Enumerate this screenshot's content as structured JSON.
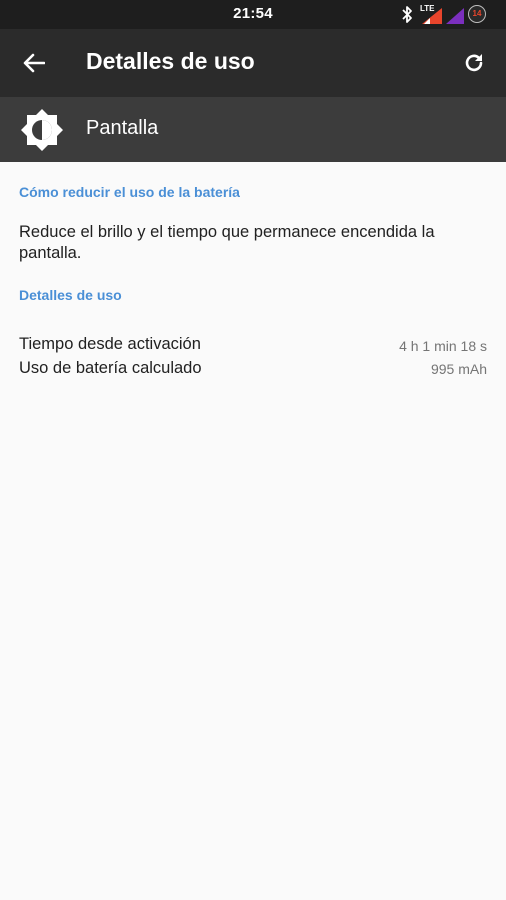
{
  "status_bar": {
    "time": "21:54",
    "icons": [
      "bluetooth-icon",
      "lte-signal-icon",
      "wifi-signal-icon",
      "battery-icon"
    ],
    "network_label": "LTE",
    "battery_level": "14"
  },
  "app_bar": {
    "title": "Detalles de uso",
    "back_icon": "back-arrow-icon",
    "refresh_icon": "refresh-icon"
  },
  "header": {
    "icon": "brightness-icon",
    "label": "Pantalla"
  },
  "tips": {
    "heading": "Cómo reducir el uso de la batería",
    "text": "Reduce el brillo y el tiempo que permanece encendida la pantalla."
  },
  "usage": {
    "heading": "Detalles de uso",
    "rows": [
      {
        "label": "Tiempo desde activación",
        "value": "4 h 1 min 18 s"
      },
      {
        "label": "Uso de batería calculado",
        "value": "995 mAh"
      }
    ]
  },
  "colors": {
    "accent": "#4a8fd6",
    "status_bar": "#1e1e1e",
    "app_bar": "#2b2b2b",
    "header_bar": "#3c3c3c",
    "background": "#fafafa",
    "signal_red": "#e8452c",
    "signal_purple": "#7b2fbe"
  }
}
